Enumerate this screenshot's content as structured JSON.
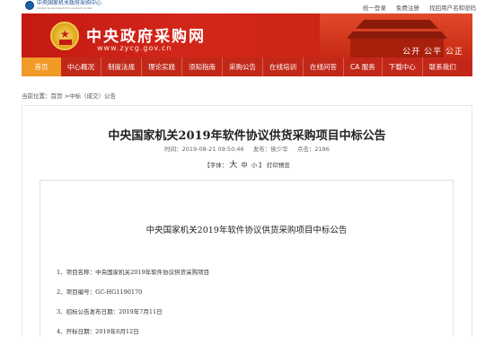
{
  "topbar": {
    "logo_text": "中央国家机关政府采购中心",
    "logo_subtext": "Central Government Procurement Center",
    "links": [
      "统一登录",
      "免费注册",
      "找回用户名和密码"
    ]
  },
  "banner": {
    "title": "中央政府采购网",
    "url": "www.zycg.gov.cn",
    "slogan": "公开 公平 公正"
  },
  "nav": {
    "items": [
      "首页",
      "中心概况",
      "制度法规",
      "理论实践",
      "须知指南",
      "采购公告",
      "在线培训",
      "在线问答",
      "CA 服务",
      "下载中心",
      "联系我们"
    ]
  },
  "breadcrumb": "当前位置：首页 >中标（成交）公告",
  "article": {
    "title": "中央国家机关2019年软件协议供货采购项目中标公告",
    "meta": {
      "time": "时间：2019-08-21 09:50:46",
      "publisher": "发布：侯少华",
      "clicks": "点击：2186"
    },
    "font": {
      "open": "【字体：",
      "big": "大",
      "mid": "中",
      "small": "小",
      "close": "】",
      "print": "打印预览"
    },
    "inner_title": "中央国家机关2019年软件协议供货采购项目中标公告",
    "lines": [
      "1、项目名称：中央国家机关2019年软件协议供货采购项目",
      "2、项目编号：GC-HG1190170",
      "3、招标公告发布日期：2019年7月11日",
      "4、开标日期：2019年8月12日"
    ]
  }
}
